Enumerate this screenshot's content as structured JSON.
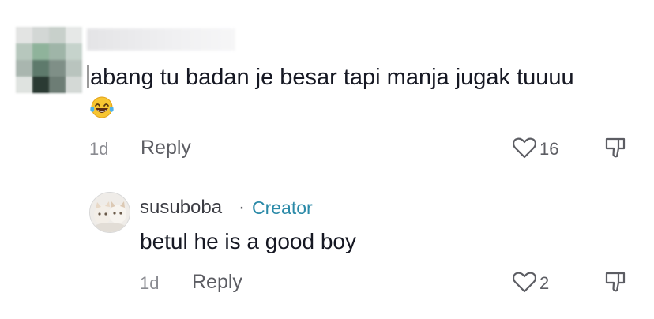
{
  "top_comment": {
    "text": "abang tu badan je besar tapi manja jugak tuuuu",
    "emoji": "😂",
    "time": "1d",
    "reply_label": "Reply",
    "likes": "16"
  },
  "reply_comment": {
    "username": "susuboba",
    "separator": "·",
    "badge": "Creator",
    "text": "betul he is a good boy",
    "time": "1d",
    "reply_label": "Reply",
    "likes": "2"
  },
  "colors": {
    "text": "#161823",
    "muted": "#8a8b91",
    "creator": "#2b8aa8"
  }
}
